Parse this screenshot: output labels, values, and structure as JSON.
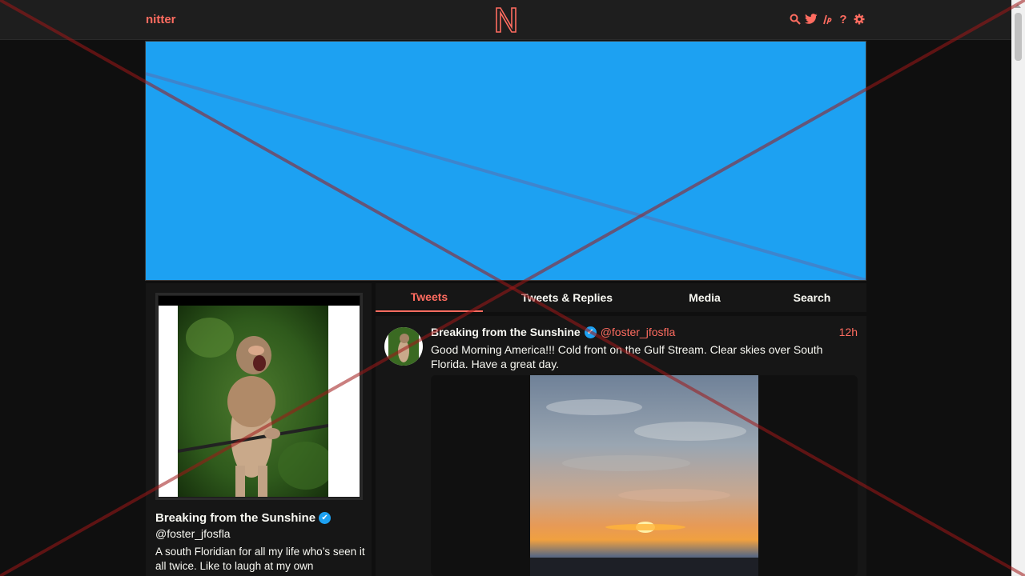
{
  "navbar": {
    "brand": "nitter",
    "icons": [
      "search-icon",
      "twitter-icon",
      "rss-icon",
      "help-icon",
      "settings-icon"
    ]
  },
  "banner": {
    "color": "#1da1f2"
  },
  "profile": {
    "fullname": "Breaking from the Sunshine",
    "verified_glyph": "✔",
    "handle": "@foster_jfosfla",
    "bio": "A south Floridian for all my life who’s seen it all twice. Like to laugh at my own"
  },
  "tabs": [
    {
      "label": "Tweets",
      "active": true
    },
    {
      "label": "Tweets & Replies",
      "active": false
    },
    {
      "label": "Media",
      "active": false
    },
    {
      "label": "Search",
      "active": false
    }
  ],
  "tweet": {
    "fullname": "Breaking from the Sunshine",
    "verified_glyph": "✔",
    "username": "@foster_jfosfla",
    "date": "12h",
    "text": "Good Morning America!!! Cold front on the Gulf Stream. Clear skies over South Florida. Have a great day."
  },
  "colors": {
    "accent": "#ff6c60",
    "background": "#0f0f0f",
    "panel": "#161616",
    "verified": "#1da1f2"
  }
}
